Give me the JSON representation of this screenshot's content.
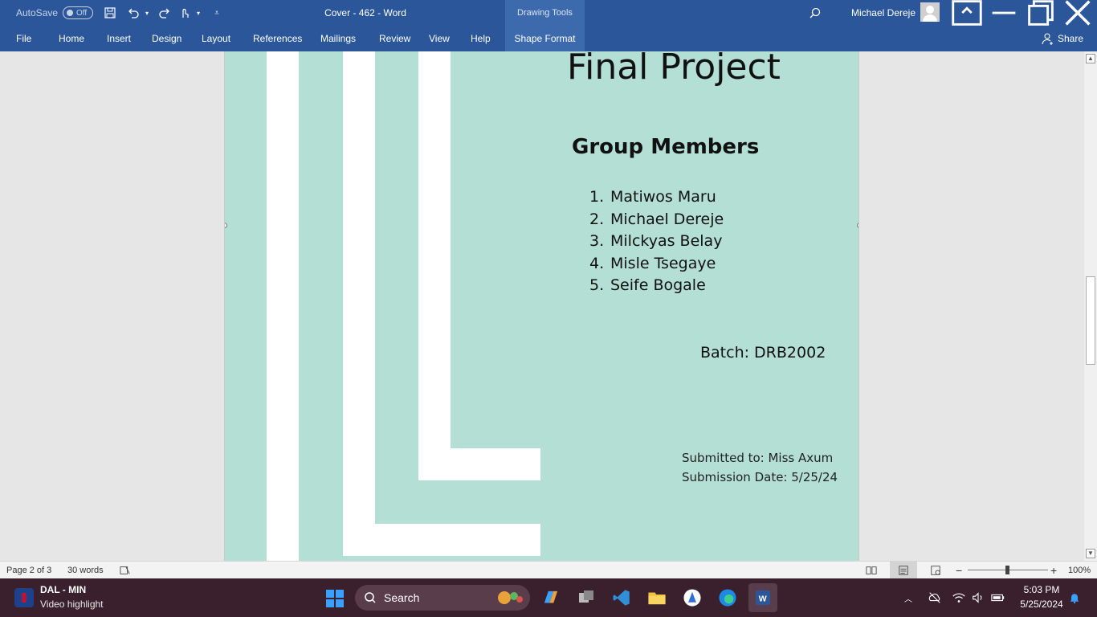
{
  "titlebar": {
    "autosave_label": "AutoSave",
    "autosave_state": "Off",
    "document_title": "Cover - 462  -  Word",
    "contextual_group": "Drawing Tools",
    "user_name": "Michael Dereje"
  },
  "ribbon": {
    "tabs": [
      "File",
      "Home",
      "Insert",
      "Design",
      "Layout",
      "References",
      "Mailings",
      "Review",
      "View",
      "Help",
      "Shape Format"
    ],
    "share_label": "Share"
  },
  "document": {
    "heading": "Final Project",
    "group_heading": "Group Members",
    "members": [
      {
        "num": "1.",
        "name": "Matiwos Maru"
      },
      {
        "num": "2.",
        "name": "Michael Dereje"
      },
      {
        "num": "3.",
        "name": "Milckyas Belay"
      },
      {
        "num": "4.",
        "name": "Misle Tsegaye"
      },
      {
        "num": "5.",
        "name": "Seife Bogale"
      }
    ],
    "batch": "Batch: DRB2002",
    "submitted_to": "Submitted to: Miss Axum",
    "submission_date": "Submission Date: 5/25/24",
    "page_color": "#b3dfd5"
  },
  "statusbar": {
    "page_info": "Page 2 of 3",
    "word_count": "30 words",
    "zoom_label": "100%"
  },
  "taskbar": {
    "news_title": "DAL - MIN",
    "news_subtitle": "Video highlight",
    "search_label": "Search",
    "clock_time": "5:03 PM",
    "clock_date": "5/25/2024"
  },
  "colors": {
    "word_blue": "#2b579a",
    "taskbar": "#3a1f2c"
  }
}
